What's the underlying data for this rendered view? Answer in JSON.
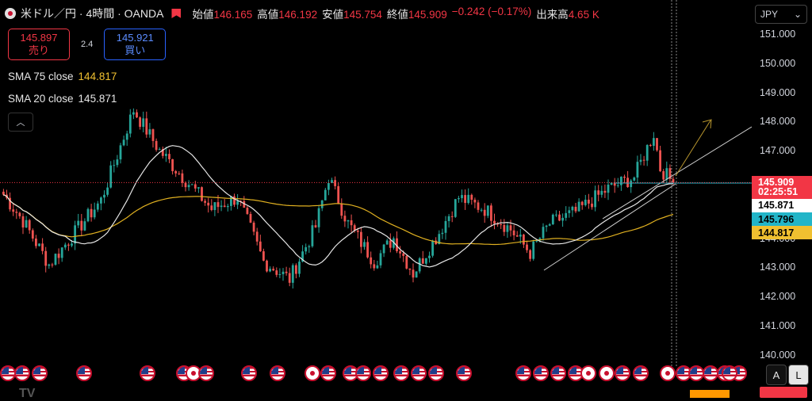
{
  "header": {
    "symbol": "米ドル／円 · 4時間 · OANDA",
    "ohlc": [
      {
        "label": "始値",
        "value": "146.165"
      },
      {
        "label": "高値",
        "value": "146.192"
      },
      {
        "label": "安値",
        "value": "145.754"
      },
      {
        "label": "終値",
        "value": "145.909"
      }
    ],
    "change": "−0.242 (−0.17%)",
    "volume_label": "出来高",
    "volume_value": "4.65 K"
  },
  "trade": {
    "sell_price": "145.897",
    "sell_label": "売り",
    "spread": "2.4",
    "buy_price": "145.921",
    "buy_label": "買い"
  },
  "indicators": {
    "sma75_label": "SMA 75 close",
    "sma75_value": "144.817",
    "sma20_label": "SMA 20 close",
    "sma20_value": "145.871"
  },
  "collapse_icon": "chevron-up-icon",
  "currency": "JPY",
  "price_labels": [
    {
      "text": "145.909",
      "price": 145.909,
      "bg": "#f23645",
      "fg": "#ffffff"
    },
    {
      "text": "02:25:51",
      "price": 145.58,
      "bg": "#f23645",
      "fg": "#ffffff"
    },
    {
      "text": "145.871",
      "price": 145.12,
      "bg": "#ffffff",
      "fg": "#000000"
    },
    {
      "text": "145.796",
      "price": 144.65,
      "bg": "#22b5c8",
      "fg": "#000000"
    },
    {
      "text": "144.817",
      "price": 144.18,
      "bg": "#f0c030",
      "fg": "#000000"
    }
  ],
  "axis_buttons": {
    "auto": "A",
    "log": "L"
  },
  "colors": {
    "up": "#26a69a",
    "down": "#ef5350",
    "sma20": "#e6e6e6",
    "sma75": "#e0b020",
    "arrow": "#b8962e"
  },
  "chart_data": {
    "type": "candlestick",
    "y_ticks": [
      "151.000",
      "150.000",
      "149.000",
      "148.000",
      "147.000",
      "146.000",
      "145.000",
      "144.000",
      "143.000",
      "142.000",
      "141.000",
      "140.000"
    ],
    "ylim": [
      140.0,
      151.2
    ],
    "waypoints": [
      [
        0,
        145.5
      ],
      [
        6,
        144.6
      ],
      [
        14,
        143.1
      ],
      [
        22,
        144.2
      ],
      [
        30,
        145.3
      ],
      [
        40,
        148.4
      ],
      [
        48,
        147.0
      ],
      [
        56,
        146.0
      ],
      [
        64,
        145.0
      ],
      [
        72,
        145.4
      ],
      [
        80,
        143.2
      ],
      [
        88,
        142.6
      ],
      [
        96,
        144.4
      ],
      [
        100,
        146.1
      ],
      [
        106,
        144.5
      ],
      [
        114,
        143.2
      ],
      [
        120,
        144.0
      ],
      [
        126,
        142.8
      ],
      [
        134,
        144.2
      ],
      [
        140,
        145.4
      ],
      [
        148,
        145.0
      ],
      [
        156,
        144.3
      ],
      [
        162,
        143.5
      ],
      [
        168,
        144.5
      ],
      [
        176,
        144.9
      ],
      [
        186,
        145.7
      ],
      [
        194,
        146.1
      ],
      [
        200,
        147.6
      ],
      [
        202,
        146.4
      ],
      [
        206,
        145.9
      ]
    ],
    "sma20_last": 145.871,
    "sma75_last": 144.817,
    "last_close": 145.909,
    "num_candles": 207,
    "events": [
      "us",
      "us",
      "us",
      "us",
      "us",
      "us",
      "jp",
      "us",
      "us",
      "us",
      "jp",
      "us",
      "us",
      "us",
      "us",
      "us",
      "us",
      "us",
      "us",
      "us",
      "us",
      "us",
      "us",
      "jp",
      "jp",
      "us",
      "us",
      "jp",
      "us",
      "us",
      "us",
      "us",
      "us",
      "us"
    ]
  }
}
